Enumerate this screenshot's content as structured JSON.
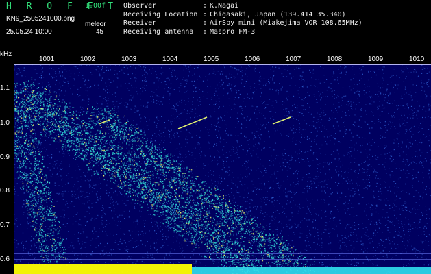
{
  "header": {
    "brand": "H R O F F T",
    "version": "1.00f",
    "filename": "KN9_2505241000.png",
    "mode": "meleor",
    "datetime": "25.05.24 10:00",
    "count": "45"
  },
  "info": [
    {
      "key": "Observer",
      "value": "K.Nagai"
    },
    {
      "key": "Receiving Location",
      "value": "Chigasaki, Japan (139.414 35.340)"
    },
    {
      "key": "Receiver",
      "value": "AirSpy mini (Miakejima VOR 108.65MHz)"
    },
    {
      "key": "Receiving antenna",
      "value": "Maspro FM-3"
    }
  ],
  "axes": {
    "y_unit": "kHz",
    "y_ticks": [
      "1.1",
      "1.0",
      "0.9",
      "0.8",
      "0.7",
      "0.6"
    ],
    "x_ticks": [
      "1001",
      "1002",
      "1003",
      "1004",
      "1005",
      "1006",
      "1007",
      "1008",
      "1009",
      "1010"
    ]
  },
  "colors": {
    "background": "#000000",
    "plot_bg": "#000060",
    "noise": "#2f5fd0",
    "signal": "#2fd0d0",
    "strong": "#e0f070",
    "brand": "#32e07a",
    "bottom_band": "#ffff00"
  }
}
